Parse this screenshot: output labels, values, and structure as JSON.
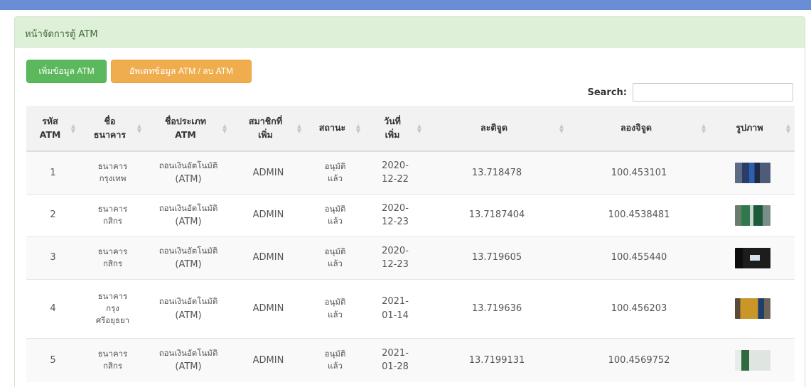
{
  "panel": {
    "title": "หน้าจัดการตู้ ATM"
  },
  "toolbar": {
    "add_label": "เพิ่มข้อมูล ATM",
    "edit_label": "อัพเดทข้อมูล ATM / ลบ ATM"
  },
  "search": {
    "label": "Search:",
    "value": ""
  },
  "table": {
    "columns": [
      {
        "line1": "รหัส",
        "line2": "ATM"
      },
      {
        "line1": "ชื่อ",
        "line2": "ธนาคาร"
      },
      {
        "line1": "ชื่อประเภท",
        "line2": "ATM"
      },
      {
        "line1": "สมาชิกที่",
        "line2": "เพิ่ม"
      },
      {
        "line1": "สถานะ",
        "line2": ""
      },
      {
        "line1": "วันที่",
        "line2": "เพิ่ม"
      },
      {
        "line1": "ละติจูด",
        "line2": ""
      },
      {
        "line1": "ลองจิจูด",
        "line2": ""
      },
      {
        "line1": "รูปภาพ",
        "line2": ""
      }
    ],
    "rows": [
      {
        "id": "1",
        "bank1": "ธนาคาร",
        "bank2": "กรุงเทพ",
        "bank3": "",
        "type1": "ถอนเงินอัตโนมัติ",
        "type2": "(ATM)",
        "member": "ADMIN",
        "status1": "อนุมัติ",
        "status2": "แล้ว",
        "date1": "2020-",
        "date2": "12-22",
        "lat": "13.718478",
        "lng": "100.453101",
        "image": "atm-photo"
      },
      {
        "id": "2",
        "bank1": "ธนาคาร",
        "bank2": "กสิกร",
        "bank3": "",
        "type1": "ถอนเงินอัตโนมัติ",
        "type2": "(ATM)",
        "member": "ADMIN",
        "status1": "อนุมัติ",
        "status2": "แล้ว",
        "date1": "2020-",
        "date2": "12-23",
        "lat": "13.7187404",
        "lng": "100.4538481",
        "image": "atm-photo"
      },
      {
        "id": "3",
        "bank1": "ธนาคาร",
        "bank2": "กสิกร",
        "bank3": "",
        "type1": "ถอนเงินอัตโนมัติ",
        "type2": "(ATM)",
        "member": "ADMIN",
        "status1": "อนุมัติ",
        "status2": "แล้ว",
        "date1": "2020-",
        "date2": "12-23",
        "lat": "13.719605",
        "lng": "100.455440",
        "image": "atm-photo"
      },
      {
        "id": "4",
        "bank1": "ธนาคาร",
        "bank2": "กรุง",
        "bank3": "ศรีอยุธยา",
        "type1": "ถอนเงินอัตโนมัติ",
        "type2": "(ATM)",
        "member": "ADMIN",
        "status1": "อนุมัติ",
        "status2": "แล้ว",
        "date1": "2021-",
        "date2": "01-14",
        "lat": "13.719636",
        "lng": "100.456203",
        "image": "atm-photo"
      },
      {
        "id": "5",
        "bank1": "ธนาคาร",
        "bank2": "กสิกร",
        "bank3": "",
        "type1": "ถอนเงินอัตโนมัติ",
        "type2": "(ATM)",
        "member": "ADMIN",
        "status1": "อนุมัติ",
        "status2": "แล้ว",
        "date1": "2021-",
        "date2": "01-28",
        "lat": "13.7199131",
        "lng": "100.4569752",
        "image": "atm-photo"
      }
    ]
  }
}
